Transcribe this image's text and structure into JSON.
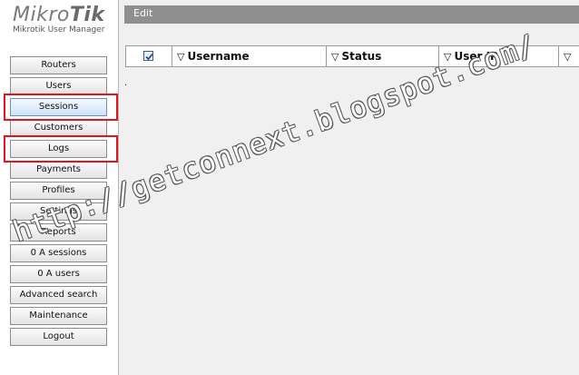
{
  "logo": {
    "brand": "MikroTik",
    "brand_prefix": "Mikro",
    "brand_suffix": "Tik",
    "subtitle": "Mikrotik User Manager"
  },
  "sidebar": {
    "items": [
      {
        "label": "Routers"
      },
      {
        "label": "Users"
      },
      {
        "label": "Sessions"
      },
      {
        "label": "Customers"
      },
      {
        "label": "Logs"
      },
      {
        "label": "Payments"
      },
      {
        "label": "Profiles"
      },
      {
        "label": "Settings"
      },
      {
        "label": "Reports"
      },
      {
        "label": "0 A sessions"
      },
      {
        "label": "0 A users"
      },
      {
        "label": "Advanced search"
      },
      {
        "label": "Maintenance"
      },
      {
        "label": "Logout"
      }
    ],
    "active_item": "Sessions"
  },
  "main": {
    "toolbar": {
      "edit_label": "Edit"
    },
    "table": {
      "select_all_checked": true,
      "columns": [
        {
          "label": "Username"
        },
        {
          "label": "Status"
        },
        {
          "label": "User IP"
        },
        {
          "label": ""
        }
      ],
      "sort_glyph": "▽"
    },
    "empty_marker": "."
  },
  "watermark": {
    "text": "http://getconnext.blogspot.com/"
  },
  "colors": {
    "highlight_border": "#e5141c",
    "edit_bar": "#8f8f8f",
    "active_button": "#cfe4f6",
    "main_background": "#f0f0f0"
  }
}
